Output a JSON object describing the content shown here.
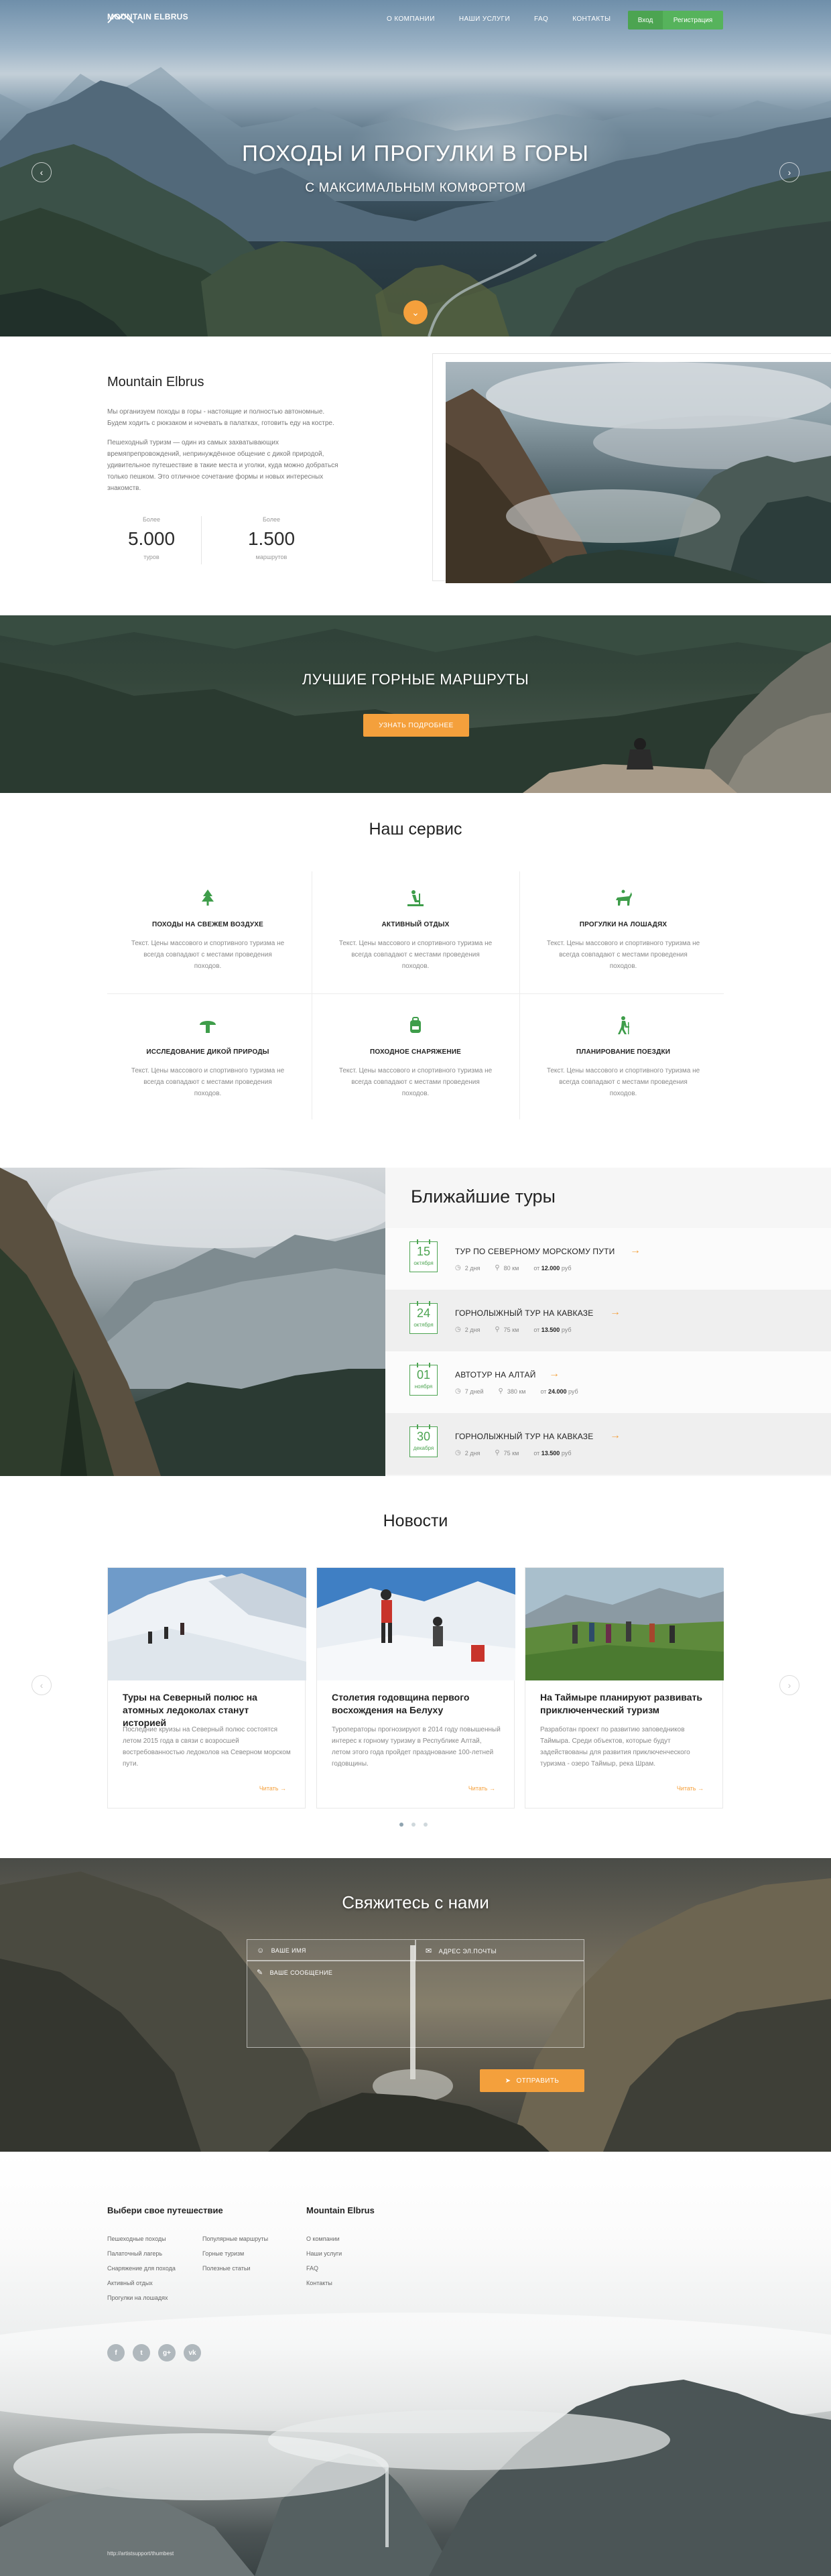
{
  "nav": {
    "logo": "MOUNTAIN ELBRUS",
    "menu": [
      "О КОМПАНИИ",
      "НАШИ УСЛУГИ",
      "FAQ",
      "КОНТАКТЫ"
    ],
    "login": "Вход",
    "register": "Регистрация"
  },
  "hero": {
    "title": "ПОХОДЫ И ПРОГУЛКИ В ГОРЫ",
    "subtitle": "С МАКСИМАЛЬНЫМ КОМФОРТОМ"
  },
  "about": {
    "title": "Mountain Elbrus",
    "p1": "Мы организуем походы в горы - настоящие и полностью автономные. Будем ходить с рюкзаком и ночевать в палатках, готовить еду на костре.",
    "p2": "Пешеходный туризм — один из самых захватывающих времяпрепровождений, непринуждённое общение с дикой природой, удивительное путешествие в такие места и уголки, куда можно добраться только пешком. Это отличное сочетание формы и новых интересных знакомств.",
    "stats": [
      {
        "pre": "Более",
        "num": "5.000",
        "unit": "туров"
      },
      {
        "pre": "Более",
        "num": "1.500",
        "unit": "маршрутов"
      }
    ]
  },
  "banner": {
    "title": "ЛУЧШИЕ ГОРНЫЕ МАРШРУТЫ",
    "button": "УЗНАТЬ ПОДРОБНЕЕ"
  },
  "services": {
    "title": "Наш сервис",
    "items": [
      {
        "icon": "tree-icon",
        "name": "ПОХОДЫ НА СВЕЖЕМ ВОЗДУХЕ",
        "desc": "Текст. Цены массового и спортивного туризма не всегда совпадают с местами проведения походов."
      },
      {
        "icon": "active-rest-icon",
        "name": "АКТИВНЫЙ ОТДЫХ",
        "desc": "Текст. Цены массового и спортивного туризма не всегда совпадают с местами проведения походов."
      },
      {
        "icon": "horse-icon",
        "name": "ПРОГУЛКИ НА ЛОШАДЯХ",
        "desc": "Текст. Цены массового и спортивного туризма не всегда совпадают с местами проведения походов."
      },
      {
        "icon": "mushroom-icon",
        "name": "ИССЛЕДОВАНИЕ ДИКОЙ ПРИРОДЫ",
        "desc": "Текст. Цены массового и спортивного туризма не всегда совпадают с местами проведения походов."
      },
      {
        "icon": "backpack-icon",
        "name": "ПОХОДНОЕ СНАРЯЖЕНИЕ",
        "desc": "Текст. Цены массового и спортивного туризма не всегда совпадают с местами проведения походов."
      },
      {
        "icon": "hiker-icon",
        "name": "ПЛАНИРОВАНИЕ ПОЕЗДКИ",
        "desc": "Текст. Цены массового и спортивного туризма не всегда совпадают с местами проведения походов."
      }
    ]
  },
  "tours": {
    "title": "Ближайшие туры",
    "items": [
      {
        "day": "15",
        "month": "октября",
        "name": "ТУР ПО СЕВЕРНОМУ МОРСКОМУ ПУТИ",
        "days": "2 дня",
        "distance": "80 км",
        "price_pre": "от",
        "price": "12.000",
        "currency": "руб"
      },
      {
        "day": "24",
        "month": "октября",
        "name": "ГОРНОЛЫЖНЫЙ ТУР НА КАВКАЗЕ",
        "days": "2 дня",
        "distance": "75 км",
        "price_pre": "от",
        "price": "13.500",
        "currency": "руб"
      },
      {
        "day": "01",
        "month": "ноября",
        "name": "АВТОТУР НА АЛТАЙ",
        "days": "7 дней",
        "distance": "380 км",
        "price_pre": "от",
        "price": "24.000",
        "currency": "руб"
      },
      {
        "day": "30",
        "month": "декабря",
        "name": "ГОРНОЛЫЖНЫЙ ТУР НА КАВКАЗЕ",
        "days": "2 дня",
        "distance": "75 км",
        "price_pre": "от",
        "price": "13.500",
        "currency": "руб"
      }
    ]
  },
  "news": {
    "title": "Новости",
    "items": [
      {
        "title": "Туры на Северный полюс на атомных ледоколах станут историей",
        "text": "Последние круизы на Северный полюс состоятся летом 2015 года в связи с возросшей востребованностью ледоколов на Северном морском пути.",
        "more": "Читать"
      },
      {
        "title": "Столетия годовщина первого восхождения на Белуху",
        "text": "Туроператоры прогнозируют в 2014 году повышенный интерес к горному туризму в Республике Алтай, летом этого года пройдет празднование 100-летней годовщины.",
        "more": "Читать"
      },
      {
        "title": "На Таймыре планируют развивать приключенческий туризм",
        "text": "Разработан проект по развитию заповедников Таймыра. Среди объектов, которые будут задействованы для развития приключенческого туризма - озеро Таймыр, река Шрам.",
        "more": "Читать"
      }
    ]
  },
  "contact": {
    "title": "Свяжитесь с нами",
    "name_placeholder": "ВАШЕ ИМЯ",
    "email_placeholder": "АДРЕС ЭЛ.ПОЧТЫ",
    "message_placeholder": "ВАШЕ СООБЩЕНИЕ",
    "send": "ОТПРАВИТЬ"
  },
  "footer": {
    "col1_title": "Выбери свое путешествие",
    "col1_links": [
      "Пешеходные походы",
      "Палаточный лагерь",
      "Снаряжение для похода",
      "Активный отдых",
      "Прогулки на лошадях"
    ],
    "col2_links": [
      "Популярные маршруты",
      "Горные туризм",
      "Полезные статьи"
    ],
    "col3_title": "Mountain Elbrus",
    "col3_links": [
      "О компании",
      "Наши услуги",
      "FAQ",
      "Контакты"
    ],
    "social": [
      "f",
      "t",
      "g+",
      "vk"
    ],
    "copyright": "http://artistsupport/thumbest"
  },
  "colors": {
    "accent": "#f4a03c",
    "green": "#4ca451"
  }
}
